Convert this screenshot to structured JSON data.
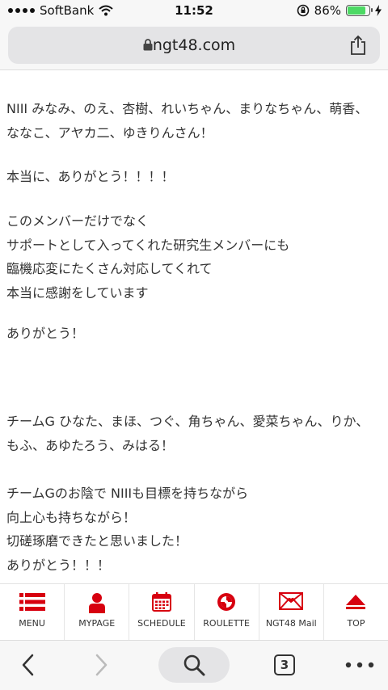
{
  "status_bar": {
    "carrier": "SoftBank",
    "time": "11:52",
    "battery": "86%",
    "battery_level": 0.86
  },
  "url_bar": {
    "domain": "ngt48.com"
  },
  "article": {
    "paragraphs": [
      "NIII みなみ、のえ、杏樹、れいちゃん、まりなちゃん、萌香、ななこ、アヤカ二、ゆきりんさん！",
      "本当に、ありがとう！！！！",
      "このメンバーだけでなく\nサポートとして入ってくれた研究生メンバーにも\n臨機応変にたくさん対応してくれて\n本当に感謝をしています",
      "ありがとう！",
      "チームG ひなた、まほ、つぐ、角ちゃん、愛菜ちゃん、りか、もふ、あゆたろう、みはる！",
      "チームGのお陰で NIIIも目標を持ちながら\n向上心も持ちながら！\n切磋琢磨できたと思いました！\nありがとう！！！"
    ]
  },
  "bottom_menu": {
    "accent_color": "#d7000f",
    "items": [
      {
        "label": "MENU",
        "icon": "menu-icon"
      },
      {
        "label": "MYPAGE",
        "icon": "person-icon"
      },
      {
        "label": "SCHEDULE",
        "icon": "calendar-icon"
      },
      {
        "label": "ROULETTE",
        "icon": "roulette-icon"
      },
      {
        "label": "NGT48 Mail",
        "icon": "mail-icon"
      },
      {
        "label": "TOP",
        "icon": "top-arrow-icon"
      }
    ]
  },
  "browser_toolbar": {
    "tab_count": "3"
  }
}
